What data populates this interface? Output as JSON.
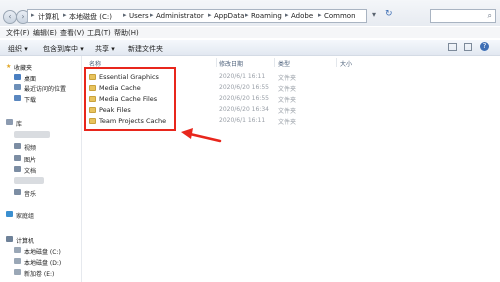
{
  "address_bar": {
    "crumbs": [
      "计算机",
      "本地磁盘 (C:)",
      "Users",
      "Administrator",
      "AppData",
      "Roaming",
      "Adobe",
      "Common"
    ]
  },
  "menu": [
    "文件(F)",
    "编辑(E)",
    "查看(V)",
    "工具(T)",
    "帮助(H)"
  ],
  "toolbar": [
    "组织 ▾",
    "包含到库中 ▾",
    "共享 ▾",
    "新建文件夹"
  ],
  "nav": {
    "favorites": "收藏夹",
    "favorite_items": [
      "桌面",
      "最近访问的位置",
      "下载"
    ],
    "libraries": "库",
    "library_items": [
      "视频",
      "图片",
      "文档",
      "音乐"
    ],
    "homegroup": "家庭组",
    "computer": "计算机",
    "drives": [
      "本地磁盘 (C:)",
      "本地磁盘 (D:)",
      "新加卷 (E:)"
    ]
  },
  "columns": {
    "name": "名称",
    "modified": "修改日期",
    "type": "类型",
    "size": "大小"
  },
  "files": [
    {
      "name": "Essential Graphics",
      "date": "2020/6/1 16:11",
      "type": "文件夹"
    },
    {
      "name": "Media Cache",
      "date": "2020/6/20 16:55",
      "type": "文件夹"
    },
    {
      "name": "Media Cache Files",
      "date": "2020/6/20 16:55",
      "type": "文件夹"
    },
    {
      "name": "Peak Files",
      "date": "2020/6/20 16:34",
      "type": "文件夹"
    },
    {
      "name": "Team Projects Cache",
      "date": "2020/6/1 16:11",
      "type": "文件夹"
    }
  ],
  "colors": {
    "annotation": "#e8261c",
    "folder": "#e8c35d"
  }
}
